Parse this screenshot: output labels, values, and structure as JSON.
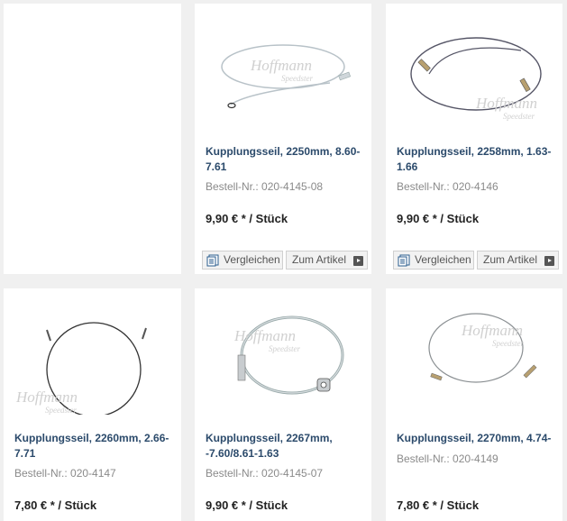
{
  "products": [
    {
      "title": "Kupplungsseil, 2250mm, 8.60-7.61",
      "sku": "Bestell-Nr.: 020-4145-08",
      "price": "9,90 € * / Stück",
      "compare_label": "Vergleichen",
      "article_label": "Zum Artikel",
      "image_icon": "clutch-cable-image"
    },
    {
      "title": "Kupplungsseil, 2258mm, 1.63-1.66",
      "sku": "Bestell-Nr.: 020-4146",
      "price": "9,90 € * / Stück",
      "compare_label": "Vergleichen",
      "article_label": "Zum Artikel",
      "image_icon": "clutch-cable-image"
    },
    {
      "title": "Kupplungsseil, 2260mm, 2.66-7.71",
      "sku": "Bestell-Nr.: 020-4147",
      "price": "7,80 € * / Stück",
      "image_icon": "clutch-cable-image"
    },
    {
      "title": "Kupplungsseil, 2267mm, -7.60/8.61-1.63",
      "sku": "Bestell-Nr.: 020-4145-07",
      "price": "9,90 € * / Stück",
      "image_icon": "clutch-cable-image"
    },
    {
      "title": "Kupplungsseil, 2270mm, 4.74-",
      "sku": "Bestell-Nr.: 020-4149",
      "price": "7,80 € * / Stück",
      "image_icon": "clutch-cable-image"
    }
  ],
  "watermark": "Hoffmann Speedster",
  "colors": {
    "title": "#2b4a6b",
    "sku": "#8a8a8a",
    "background": "#f0f0f0"
  }
}
